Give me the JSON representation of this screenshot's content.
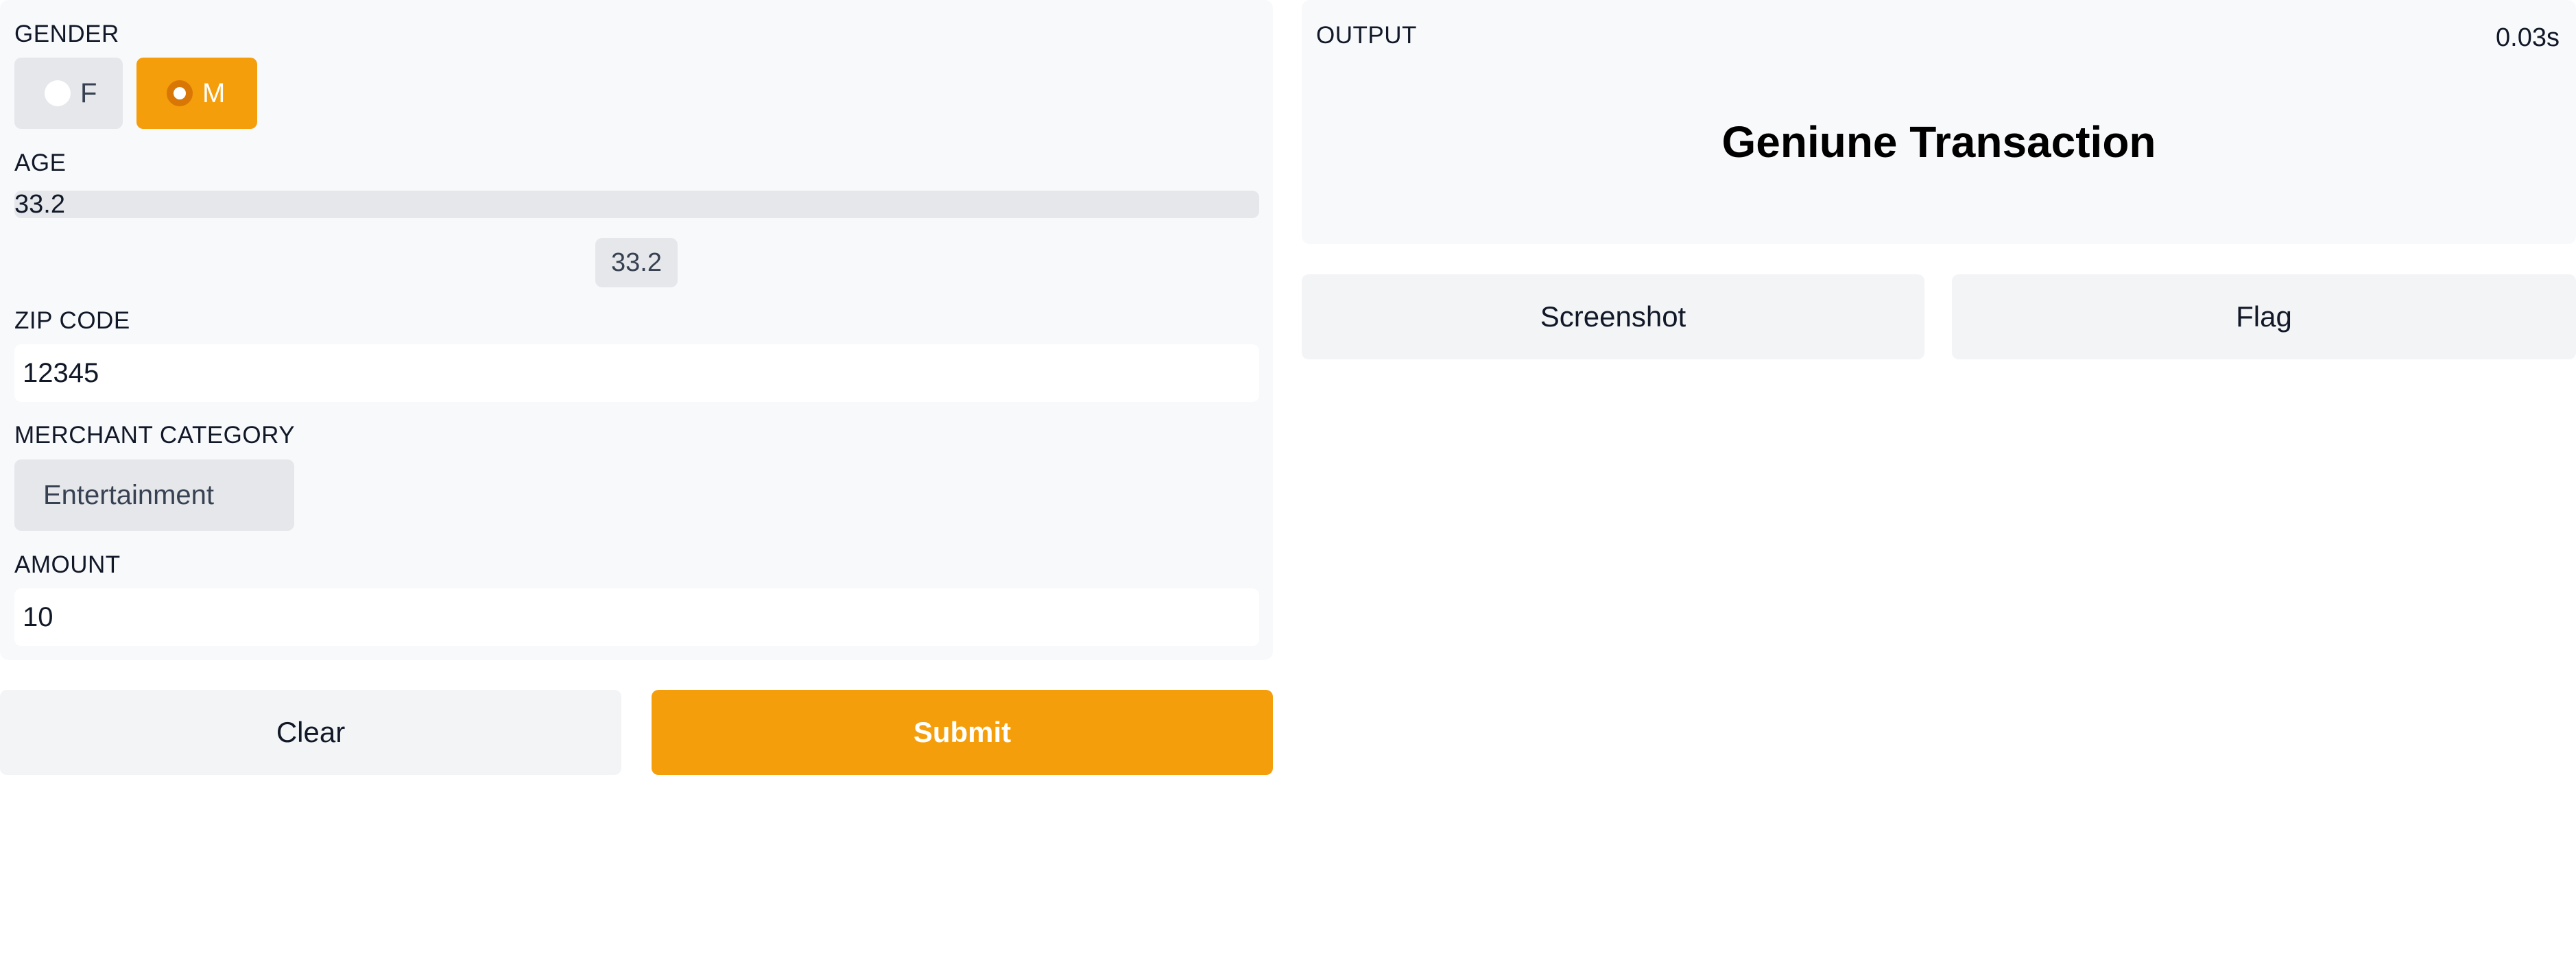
{
  "inputs": {
    "gender": {
      "label": "GENDER",
      "options": [
        {
          "label": "F",
          "checked": false
        },
        {
          "label": "M",
          "checked": true
        }
      ]
    },
    "age": {
      "label": "AGE",
      "value": "33.2",
      "number_value": "33.2"
    },
    "zip_code": {
      "label": "ZIP CODE",
      "value": "12345"
    },
    "merchant_category": {
      "label": "MERCHANT CATEGORY",
      "selected": "Entertainment"
    },
    "amount": {
      "label": "AMOUNT",
      "value": "10"
    }
  },
  "actions": {
    "clear_label": "Clear",
    "submit_label": "Submit"
  },
  "output": {
    "label": "OUTPUT",
    "time": "0.03s",
    "result": "Geniune Transaction"
  },
  "output_actions": {
    "screenshot_label": "Screenshot",
    "flag_label": "Flag"
  },
  "colors": {
    "accent": "#f59e0b",
    "accent_dark": "#d97706",
    "panel_bg": "#f8f9fb",
    "control_bg": "#e5e7eb"
  }
}
